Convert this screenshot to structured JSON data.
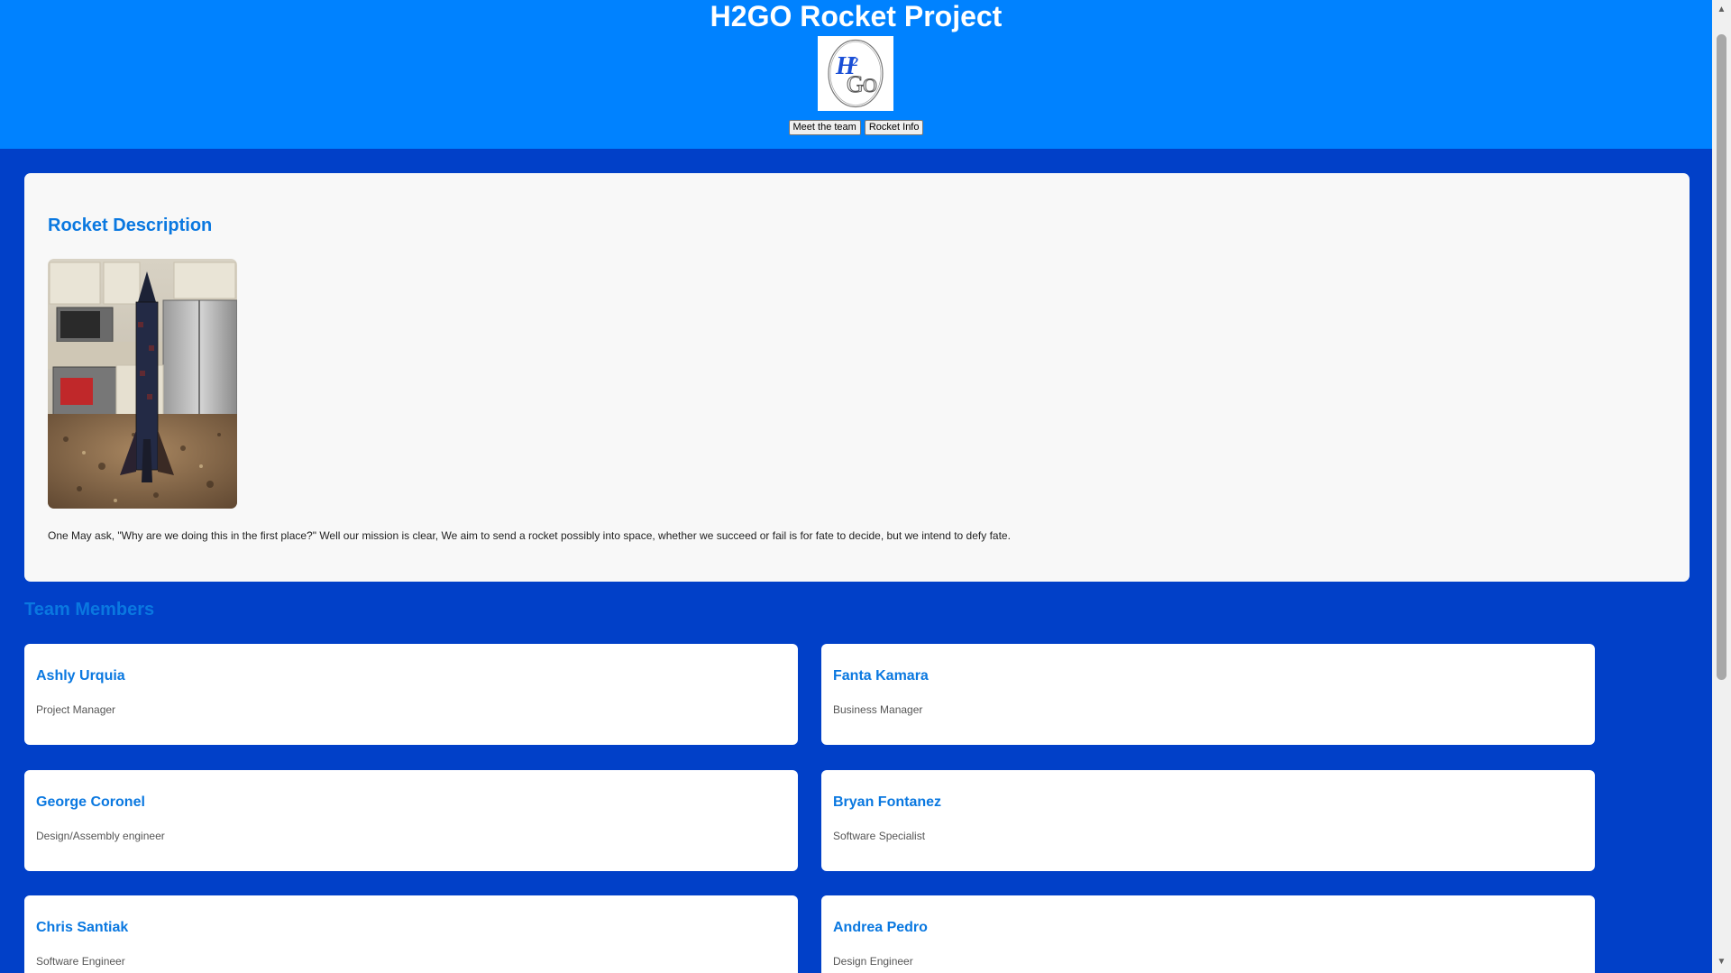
{
  "header": {
    "title": "H2GO Rocket Project",
    "logo_text": "H2GO",
    "nav": [
      {
        "label": "Meet the team"
      },
      {
        "label": "Rocket Info"
      }
    ]
  },
  "description": {
    "title": "Rocket Description",
    "text": "One May ask, \"Why are we doing this in the first place?\" Well our mission is clear, We aim to send a rocket possibly into space, whether we succeed or fail is for fate to decide, but we intend to defy fate."
  },
  "team": {
    "title": "Team Members",
    "members": [
      {
        "name": "Ashly Urquia",
        "role": "Project Manager"
      },
      {
        "name": "Fanta Kamara",
        "role": "Business Manager"
      },
      {
        "name": "George Coronel",
        "role": "Design/Assembly engineer"
      },
      {
        "name": "Bryan Fontanez",
        "role": "Software Specialist"
      },
      {
        "name": "Chris Santiak",
        "role": "Software Engineer"
      },
      {
        "name": "Andrea Pedro",
        "role": "Design Engineer"
      }
    ]
  },
  "colors": {
    "header_bg": "#0082ff",
    "page_bg": "#0140c8",
    "accent_text": "#0a78e0",
    "panel_bg": "#f8f8f8"
  }
}
